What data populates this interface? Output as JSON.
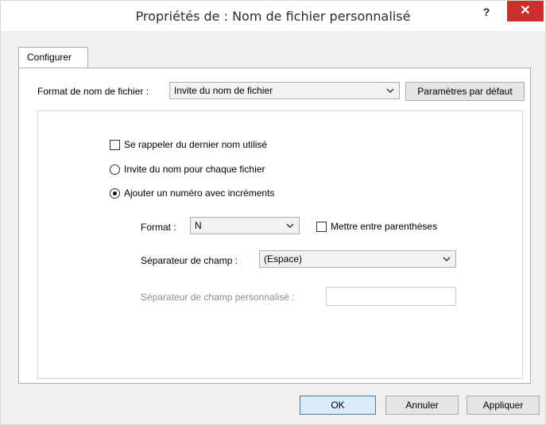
{
  "window": {
    "title": "Propriétés de : Nom de fichier personnalisé",
    "help_label": "?",
    "close_label": "✕"
  },
  "tabs": [
    {
      "label": "Configurer",
      "selected": true
    }
  ],
  "format": {
    "label": "Format de nom de fichier :",
    "value": "Invite du nom de fichier",
    "defaults_button": "Paramètres par défaut"
  },
  "options": {
    "remember_last": {
      "label": "Se rappeler du dernier nom utilisé",
      "checked": false
    },
    "prompt_each": {
      "label": "Invite du nom pour chaque fichier",
      "selected": false
    },
    "add_number": {
      "label": "Ajouter un numéro avec incréments",
      "selected": true
    }
  },
  "numbering": {
    "format_label": "Format :",
    "format_value": "N",
    "parentheses_label": "Mettre entre parenthèses",
    "parentheses_checked": false,
    "separator_label": "Séparateur de champ :",
    "separator_value": "(Espace)",
    "custom_separator_label": "Séparateur de champ personnalisé :",
    "custom_separator_value": ""
  },
  "footer": {
    "ok": "OK",
    "cancel": "Annuler",
    "apply": "Appliquer"
  },
  "icons": {
    "chevron": "⌄"
  }
}
